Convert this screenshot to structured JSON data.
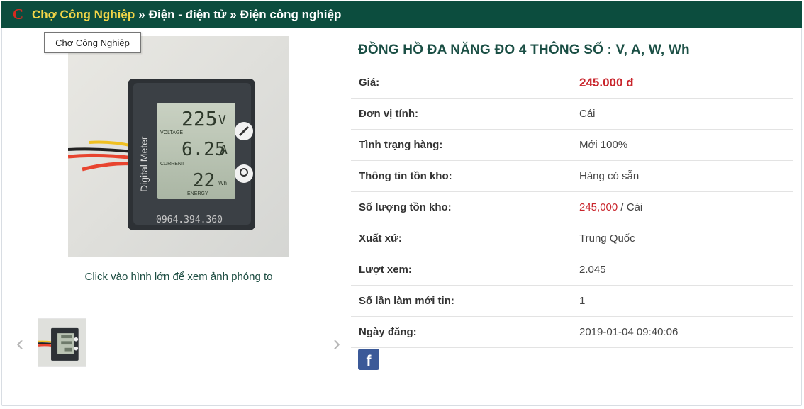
{
  "breadcrumb": {
    "logo_letter": "C",
    "home": "Chợ Công Nghiệp",
    "separator": "»",
    "category": "Điện - điện tử",
    "subcategory": "Điện công nghiệp"
  },
  "tooltip": "Chợ Công Nghiệp",
  "gallery": {
    "hint": "Click vào hình lớn để xem ảnh phóng to",
    "prev_icon": "chevron-left-icon",
    "next_icon": "chevron-right-icon",
    "meter": {
      "brand": "Digital Meter",
      "voltage": "225",
      "voltage_unit": "V",
      "voltage_label": "VOLTAGE",
      "current": "6.25",
      "current_unit": "A",
      "current_label": "CURRENT",
      "energy": "22",
      "energy_unit": "Wh",
      "energy_label": "ENERGY",
      "phone": "0964.394.360"
    }
  },
  "product": {
    "title": "ĐỒNG HỒ ĐA NĂNG ĐO 4 THÔNG SỐ : V, A, W, Wh",
    "price_label": "Giá:",
    "price": "245.000 đ",
    "unit_label": "Đơn vị tính:",
    "unit": "Cái",
    "condition_label": "Tình trạng hàng:",
    "condition": "Mới 100%",
    "stock_info_label": "Thông tin tồn kho:",
    "stock_info": "Hàng có sẵn",
    "stock_qty_label": "Số lượng tồn kho:",
    "stock_qty": "245,000",
    "stock_qty_sep": " / ",
    "stock_qty_unit": "Cái",
    "origin_label": "Xuất xứ:",
    "origin": "Trung Quốc",
    "views_label": "Lượt xem:",
    "views": "2.045",
    "refresh_label": "Số lần làm mới tin:",
    "refresh": "1",
    "posted_label": "Ngày đăng:",
    "posted": "2019-01-04 09:40:06"
  },
  "share": {
    "facebook_icon": "facebook-icon",
    "facebook_glyph": "f"
  },
  "colors": {
    "header_bg": "#0c4d3e",
    "home_link": "#f2d548",
    "logo": "#d52a20",
    "price": "#c9252c",
    "title": "#1b4f45",
    "facebook": "#3b5998"
  }
}
